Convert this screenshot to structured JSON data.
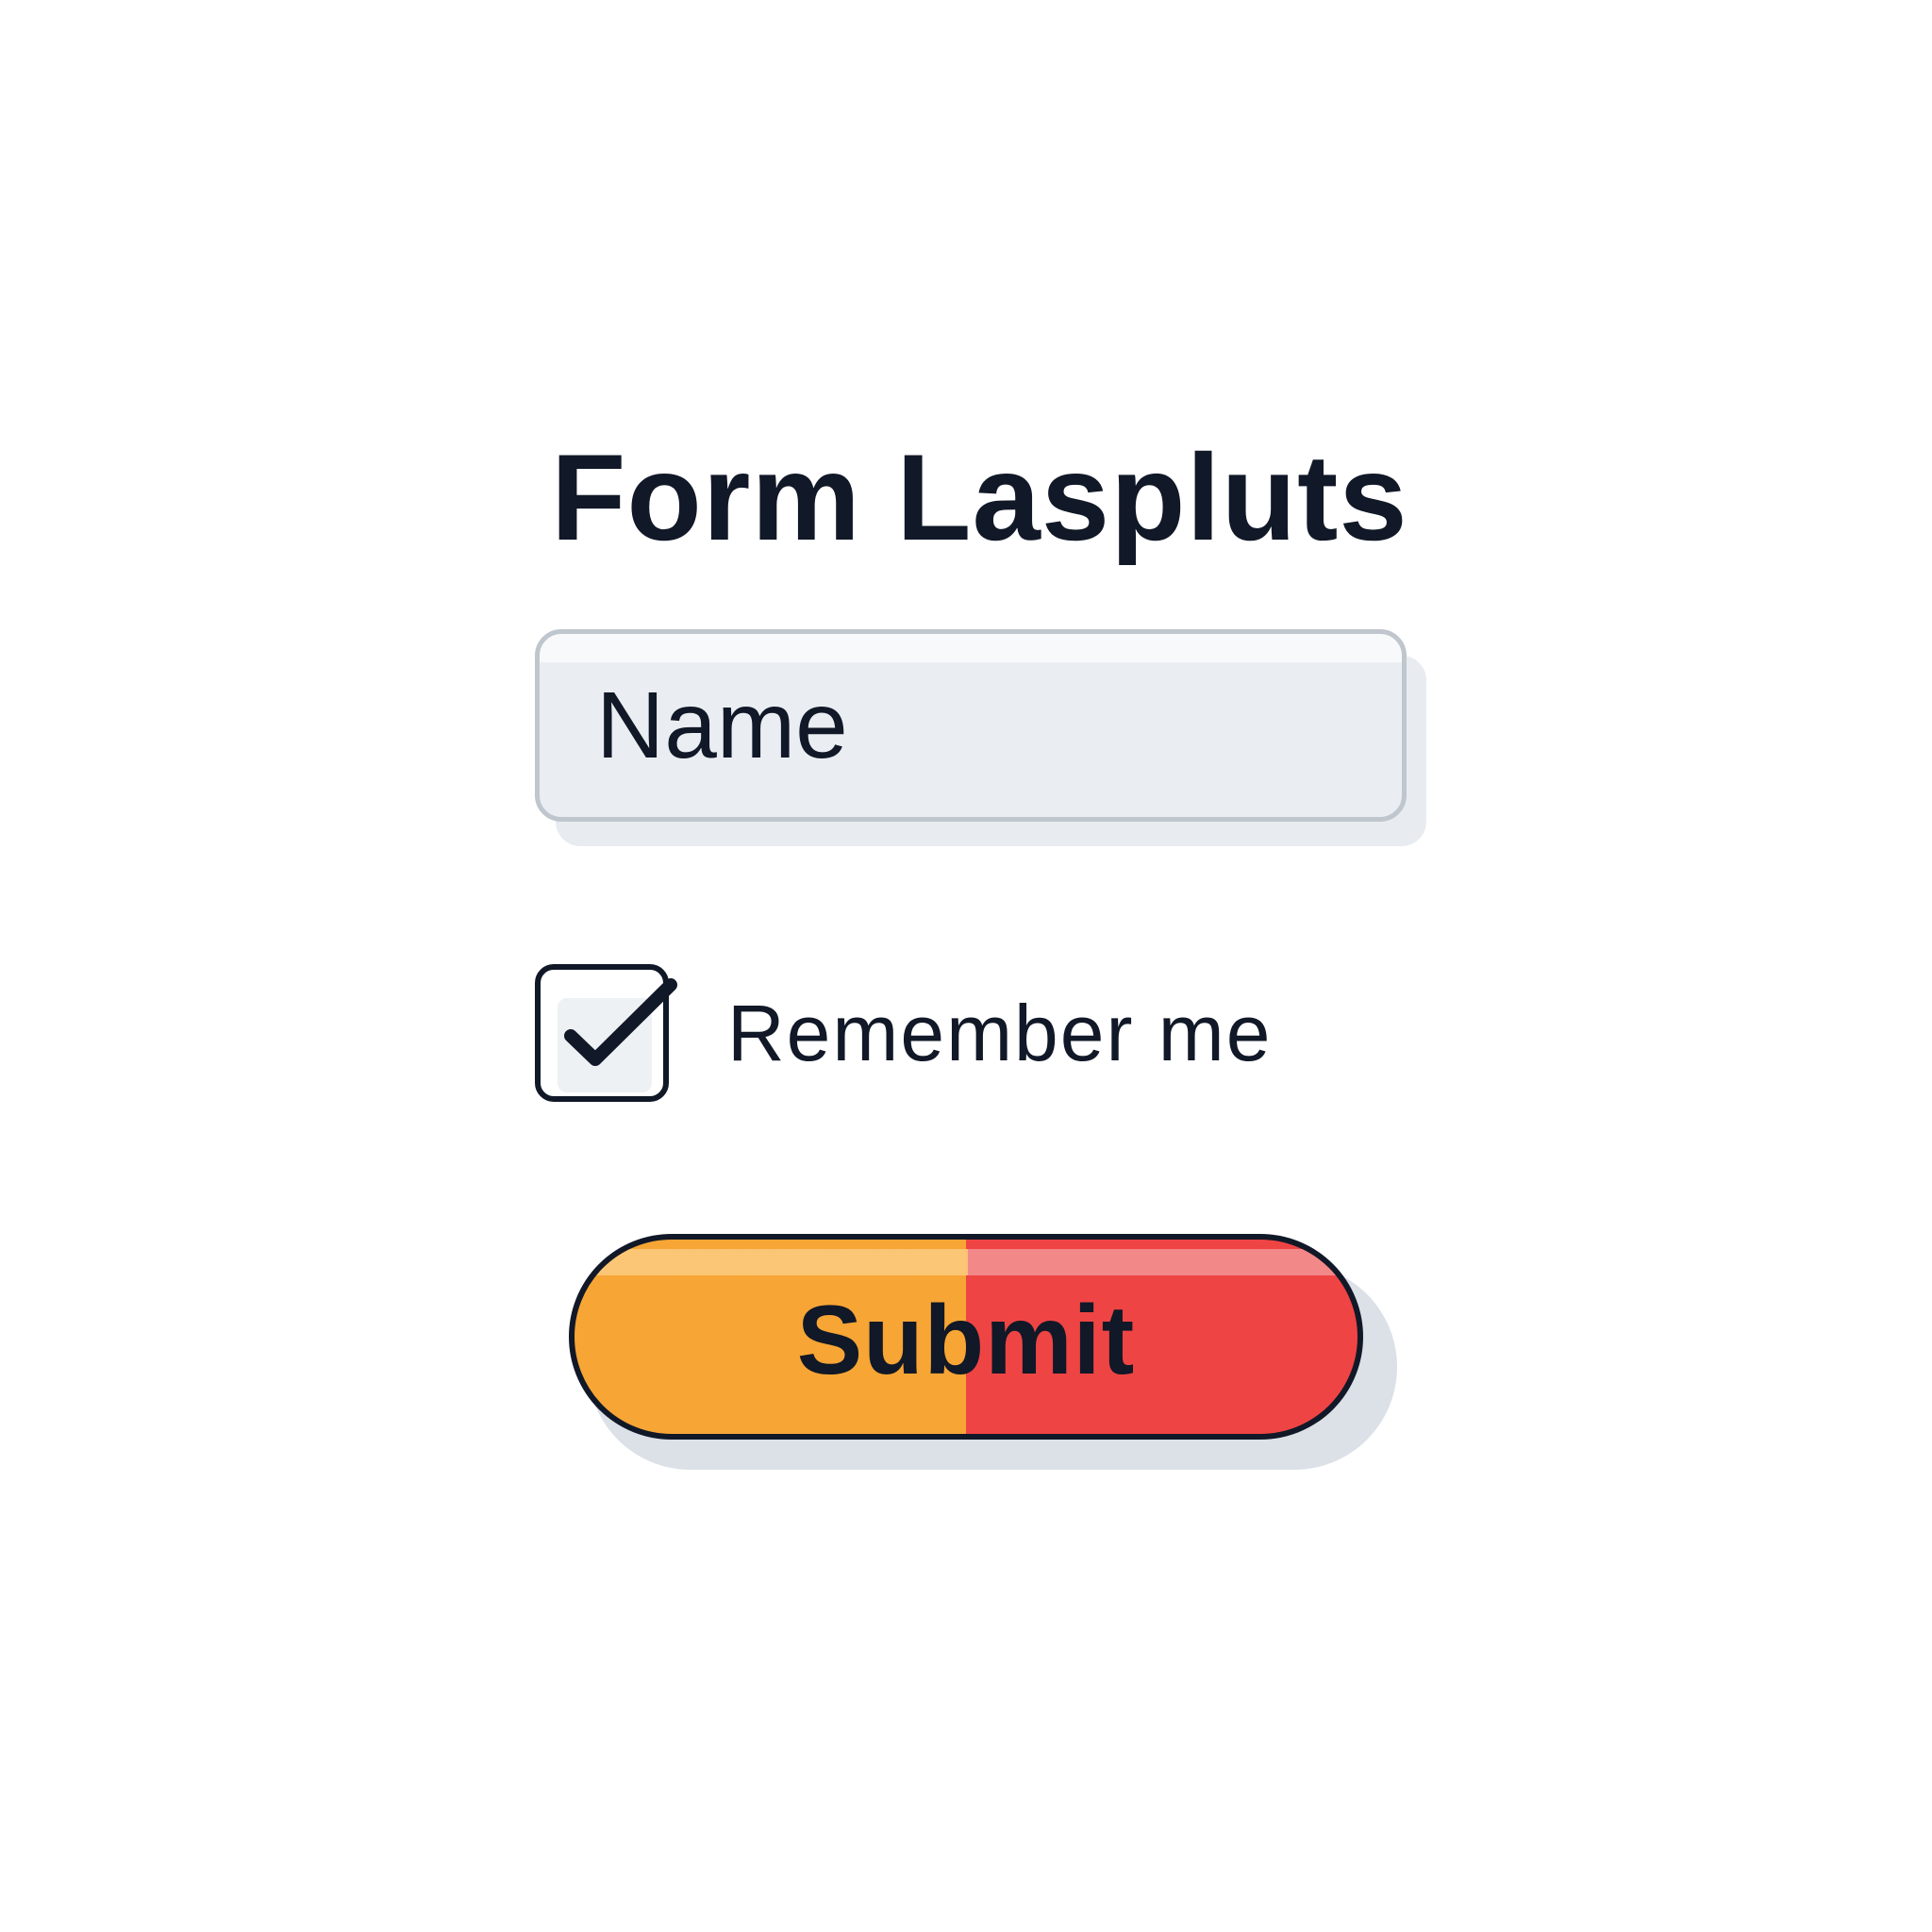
{
  "form": {
    "title": "Form Laspluts",
    "name_field": {
      "placeholder": "Name",
      "value": ""
    },
    "remember_me": {
      "label": "Remember me",
      "checked": true,
      "icon": "check-icon"
    },
    "submit": {
      "label": "Submit"
    }
  },
  "colors": {
    "text": "#111827",
    "input_background": "#eaeef2",
    "input_border": "#bfc6cd",
    "button_left": "#f7a535",
    "button_right": "#ef4444",
    "shadow": "#dbe1e7"
  }
}
